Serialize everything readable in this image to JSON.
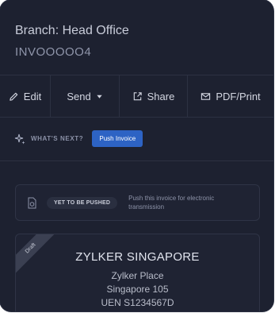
{
  "header": {
    "branch": "Branch: Head Office",
    "invoice_number": "INVOOOOO4"
  },
  "toolbar": {
    "edit_label": "Edit",
    "send_label": "Send",
    "share_label": "Share",
    "pdf_label": "PDF/Print"
  },
  "whats_next": {
    "label": "WHAT'S NEXT?",
    "button_label": "Push Invoice"
  },
  "notice": {
    "badge": "YET TO BE PUSHED",
    "message": "Push this invoice for electronic transmission"
  },
  "invoice_card": {
    "ribbon": "Draft",
    "company": "ZYLKER SINGAPORE",
    "address_line1": "Zylker Place",
    "address_line2": "Singapore 105",
    "uen": "UEN S1234567D"
  },
  "colors": {
    "panel_bg": "#1d2130",
    "accent": "#2d63c4"
  }
}
